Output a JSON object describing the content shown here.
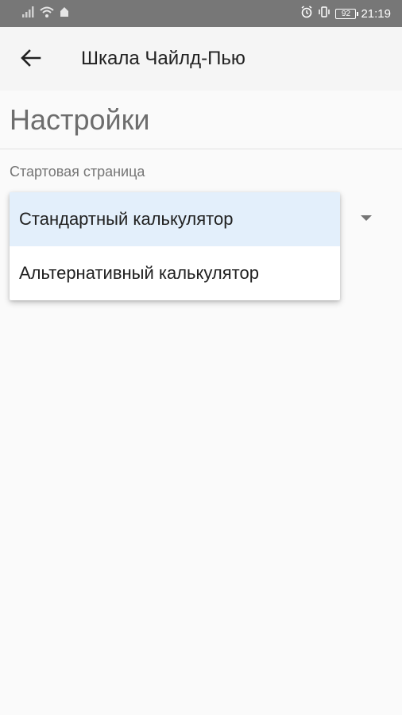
{
  "status_bar": {
    "time": "21:19",
    "battery": "92"
  },
  "app_bar": {
    "title": "Шкала Чайлд-Пью"
  },
  "settings": {
    "section_title": "Настройки",
    "start_page_label": "Стартовая страница",
    "options": [
      {
        "label": "Стандартный калькулятор",
        "selected": true
      },
      {
        "label": "Альтернативный калькулятор",
        "selected": false
      }
    ]
  },
  "colors": {
    "status_bar": "#777777",
    "app_bar": "#f5f5f5",
    "selected_item": "#e3effb"
  }
}
